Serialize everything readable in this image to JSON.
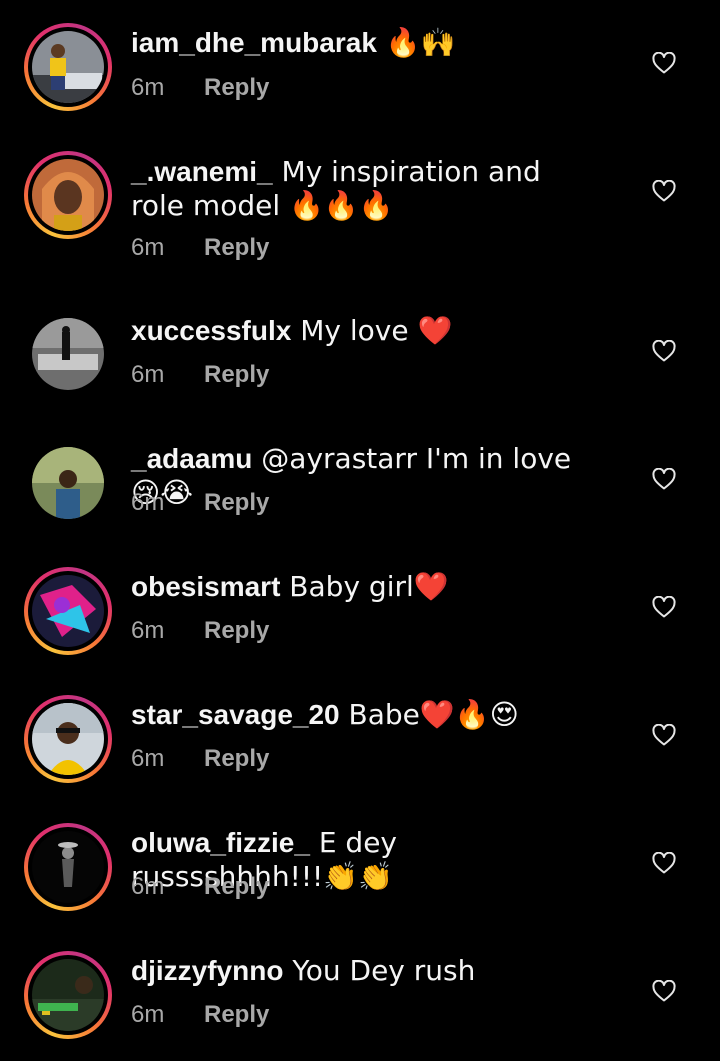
{
  "comments": [
    {
      "username": "iam_dhe_mubarak",
      "text": " 🔥🙌",
      "time": "6m",
      "reply": "Reply",
      "story_ring": true
    },
    {
      "username": "_.wanemi_",
      "text": " My inspiration and role model 🔥🔥🔥",
      "time": "6m",
      "reply": "Reply",
      "story_ring": true
    },
    {
      "username": "xuccessfulx",
      "text": " My love ❤️",
      "time": "6m",
      "reply": "Reply",
      "story_ring": false
    },
    {
      "username": "_adaamu",
      "text": " @ayrastarr I'm in love😢😭",
      "time": "6m",
      "reply": "Reply",
      "story_ring": false
    },
    {
      "username": "obesismart",
      "text": " Baby girl❤️",
      "time": "6m",
      "reply": "Reply",
      "story_ring": true
    },
    {
      "username": "star_savage_20",
      "text": " Babe❤️🔥😍",
      "time": "6m",
      "reply": "Reply",
      "story_ring": true
    },
    {
      "username": "oluwa_fizzie_",
      "text": " E dey russsshhhh!!!👏👏",
      "time": "6m",
      "reply": "Reply",
      "story_ring": true
    },
    {
      "username": "djizzyfynno",
      "text": " You Dey rush",
      "time": "6m",
      "reply": "Reply",
      "story_ring": true
    }
  ],
  "icons": {
    "like": "heart-outline-icon"
  },
  "colors": {
    "background": "#000000",
    "text_primary": "#f5f5f5",
    "text_secondary": "#a8a8a8",
    "story_ring_start": "#f9c33c",
    "story_ring_end": "#c13584"
  }
}
